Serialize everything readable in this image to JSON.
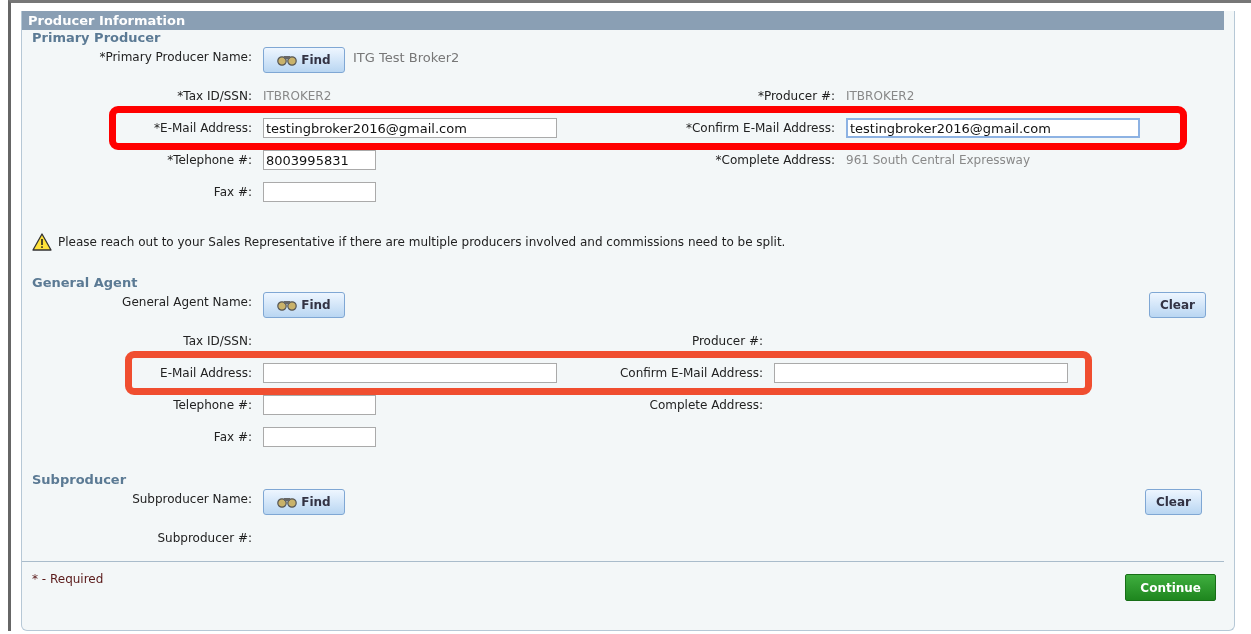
{
  "panel": {
    "title": "Producer Information"
  },
  "sections": [
    {
      "title": "Primary Producer",
      "name_label": "*Primary Producer Name:",
      "find_button": "Find",
      "name_value": "ITG Test Broker2",
      "rows": [
        {
          "left": {
            "label": "*Tax ID/SSN:",
            "kind": "text",
            "value": "ITBROKER2"
          },
          "right": {
            "label": "*Producer #:",
            "kind": "text",
            "value": "ITBROKER2"
          }
        },
        {
          "highlight": {
            "color": "#ff0000"
          },
          "left": {
            "label": "*E-Mail Address:",
            "kind": "field",
            "value": "testingbroker2016@gmail.com",
            "focused": false
          },
          "right": {
            "label": "*Confirm E-Mail Address:",
            "kind": "field",
            "value": "testingbroker2016@gmail.com",
            "focused": true
          }
        },
        {
          "left": {
            "label": "*Telephone #:",
            "kind": "short_field",
            "value": "8003995831",
            "focused": false
          },
          "right": {
            "label": "*Complete Address:",
            "kind": "text",
            "value": "961 South Central Expressway"
          }
        },
        {
          "left": {
            "label": "Fax #:",
            "kind": "short_field",
            "focused": false
          }
        }
      ],
      "note": "Please reach out to your Sales Representative if there are multiple producers involved and commissions need to be split."
    },
    {
      "title": "General Agent",
      "name_label": "General Agent Name:",
      "find_button": "Find",
      "clear_button": "Clear",
      "rows": [
        {
          "left": {
            "label": "Tax ID/SSN:",
            "kind": "text"
          },
          "right": {
            "label": "Producer #:",
            "kind": "text"
          }
        },
        {
          "highlight": {
            "color": "#f04e30"
          },
          "left": {
            "label": "E-Mail Address:",
            "kind": "field",
            "focused": false
          },
          "right": {
            "label": "Confirm E-Mail Address:",
            "kind": "field",
            "focused": false
          }
        },
        {
          "left": {
            "label": "Telephone #:",
            "kind": "short_field",
            "focused": false
          },
          "right": {
            "label": "Complete Address:",
            "kind": "text"
          }
        },
        {
          "left": {
            "label": "Fax #:",
            "kind": "short_field",
            "focused": false
          }
        }
      ]
    },
    {
      "title": "Subproducer",
      "name_label": "Subproducer Name:",
      "find_button": "Find",
      "clear_button": "Clear",
      "rows": [
        {
          "left": {
            "label": "Subproducer #:",
            "kind": "text"
          }
        }
      ]
    }
  ],
  "footer": {
    "required_note": "* - Required",
    "continue_button": "Continue"
  }
}
